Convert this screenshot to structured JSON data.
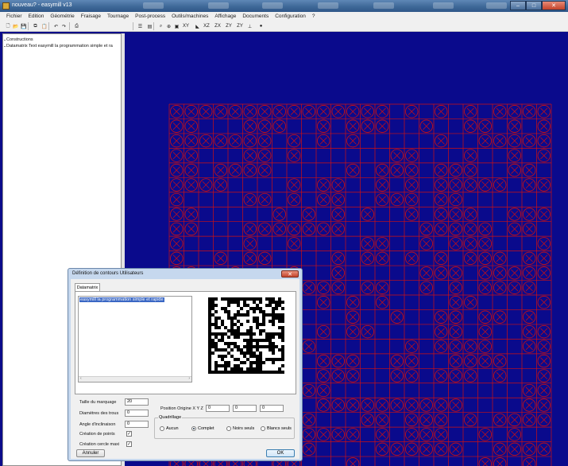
{
  "window": {
    "title": "nouveau? - easymill v13"
  },
  "menu": [
    "Fichier",
    "Edition",
    "Géométrie",
    "Fraisage",
    "Tournage",
    "Post-process",
    "Outils/machines",
    "Affichage",
    "Documents",
    "Configuration",
    "?"
  ],
  "toolbar": {
    "buttons": [
      {
        "icon": "new-file-icon",
        "glyph": "🗋"
      },
      {
        "icon": "open-folder-icon",
        "glyph": "📂"
      },
      {
        "icon": "save-icon",
        "glyph": "💾"
      },
      {
        "icon": "copy-icon",
        "glyph": "⧉"
      },
      {
        "icon": "paste-icon",
        "glyph": "📋"
      },
      {
        "icon": "undo-icon",
        "glyph": "↶"
      },
      {
        "icon": "redo-icon",
        "glyph": "↷"
      },
      {
        "icon": "print-icon",
        "glyph": "⎙"
      },
      {
        "icon": "layers-icon",
        "glyph": "☰"
      },
      {
        "icon": "list-icon",
        "glyph": "▤"
      },
      {
        "icon": "zoom-fit-icon",
        "glyph": "⌕"
      },
      {
        "icon": "zoom-in-icon",
        "glyph": "⊕"
      },
      {
        "icon": "zoom-box-icon",
        "glyph": "▣"
      },
      {
        "icon": "xy-view-icon",
        "glyph": "XY"
      },
      {
        "icon": "iso-view-icon",
        "glyph": "◣"
      },
      {
        "icon": "xz-view-icon",
        "glyph": "XZ"
      },
      {
        "icon": "zx-view-icon",
        "glyph": "ZX"
      },
      {
        "icon": "zy-view-icon",
        "glyph": "ZY"
      },
      {
        "icon": "zy2-view-icon",
        "glyph": "ZY"
      },
      {
        "icon": "axes-icon",
        "glyph": "⊥"
      },
      {
        "icon": "sphere-icon",
        "glyph": "●"
      }
    ]
  },
  "tree": {
    "items": [
      "Constructions",
      "Datamatrix Text easymill la programmation simple et ra"
    ]
  },
  "dialog": {
    "title": "Définition de contours Utilisateurs",
    "tab": "Datamatrix",
    "text": "easymill la programmation simple et rapide",
    "fields": {
      "taille_label": "Taille du marquage",
      "taille_value": "20",
      "diametre_label": "Diamètres des trous",
      "diametre_value": "0",
      "angle_label": "Angle d'inclinaison",
      "angle_value": "0",
      "points_label": "Création de points",
      "points_checked": "✓",
      "cercle_label": "Création cercle maxi",
      "cercle_checked": "✓",
      "origine_label": "Position Origine  X Y Z",
      "x": "0",
      "y": "0",
      "z": "0"
    },
    "quadrillage": {
      "label": "Quadrillage",
      "options": [
        "Aucun",
        "Complet",
        "Noirs seuls",
        "Blancs seuls"
      ],
      "selected": "Complet"
    },
    "cancel": "Annuler",
    "ok": "OK"
  },
  "colors": {
    "viewport": "#0a0a8c",
    "grid": "#d01010"
  }
}
